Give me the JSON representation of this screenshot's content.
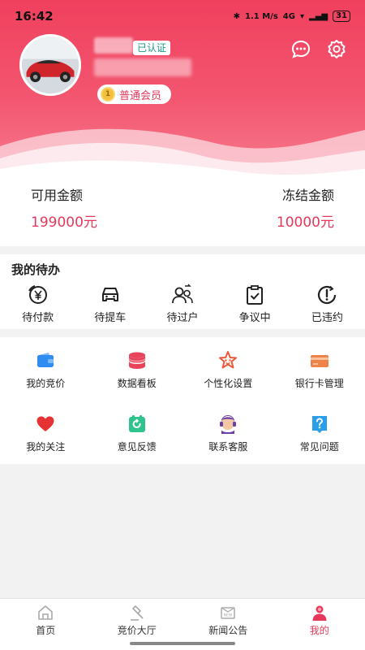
{
  "status_bar": {
    "time": "16:42",
    "net_speed": "1.1 M/s",
    "signal": "4G",
    "battery": "31"
  },
  "profile": {
    "verified_label": "已认证",
    "member_label": "普通会员"
  },
  "balance": {
    "available_label": "可用金额",
    "available_value": "199000元",
    "frozen_label": "冻结金额",
    "frozen_value": "10000元"
  },
  "todo": {
    "title": "我的待办",
    "items": [
      {
        "label": "待付款",
        "icon": "yen-icon"
      },
      {
        "label": "待提车",
        "icon": "car-icon"
      },
      {
        "label": "待过户",
        "icon": "transfer-icon"
      },
      {
        "label": "争议中",
        "icon": "clipboard-icon"
      },
      {
        "label": "已违约",
        "icon": "alert-icon"
      }
    ]
  },
  "grid": {
    "items": [
      {
        "label": "我的竞价",
        "icon": "wallet-icon",
        "color": "#2f8cf0"
      },
      {
        "label": "数据看板",
        "icon": "database-icon",
        "color": "#e8455b"
      },
      {
        "label": "个性化设置",
        "icon": "star-icon",
        "color": "#e85b3a"
      },
      {
        "label": "银行卡管理",
        "icon": "bank-card-icon",
        "color": "#f0834a"
      },
      {
        "label": "我的关注",
        "icon": "heart-icon",
        "color": "#e63232"
      },
      {
        "label": "意见反馈",
        "icon": "feedback-icon",
        "color": "#2ec48c"
      },
      {
        "label": "联系客服",
        "icon": "headset-icon",
        "color": "#6b3ea8"
      },
      {
        "label": "常见问题",
        "icon": "question-icon",
        "color": "#2a9ee8"
      }
    ]
  },
  "bottom_nav": {
    "items": [
      {
        "label": "首页",
        "icon": "home-icon",
        "active": false
      },
      {
        "label": "竞价大厅",
        "icon": "gavel-icon",
        "active": false
      },
      {
        "label": "新闻公告",
        "icon": "news-icon",
        "active": false
      },
      {
        "label": "我的",
        "icon": "user-icon",
        "active": true
      }
    ]
  },
  "colors": {
    "accent": "#e6385a",
    "header_top": "#f0405e",
    "verified": "#1a9a86"
  }
}
